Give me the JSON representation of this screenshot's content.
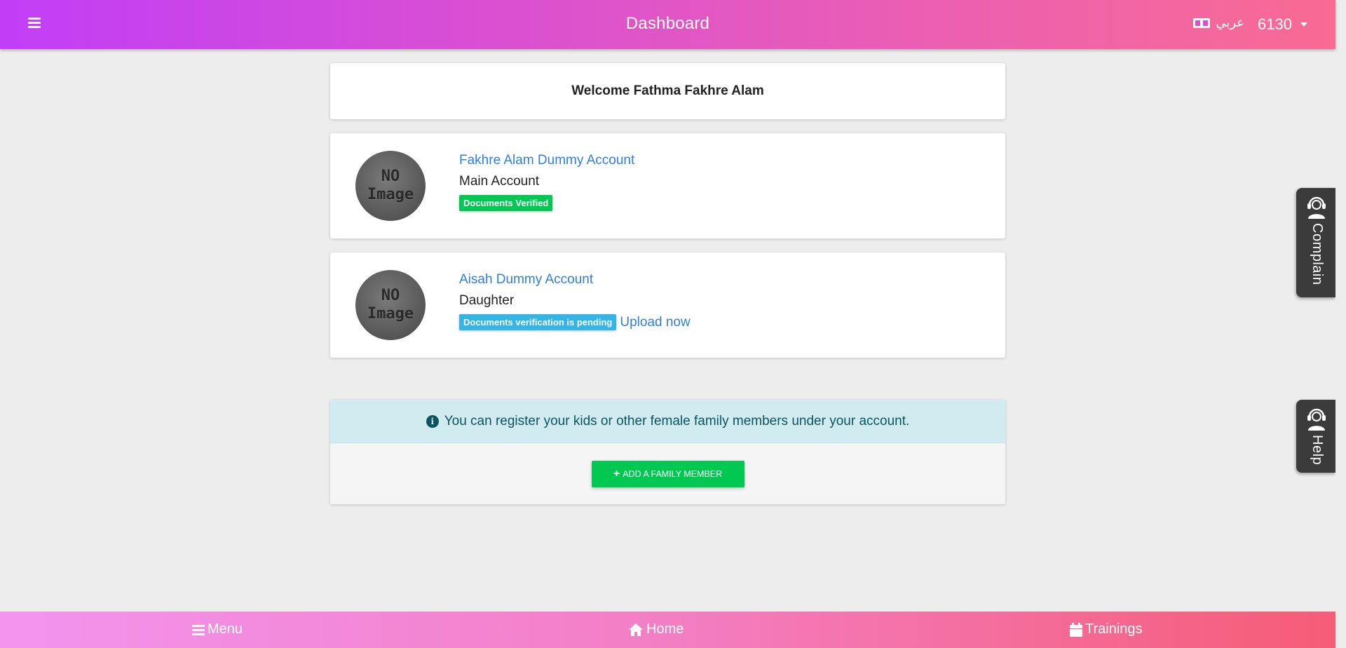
{
  "header": {
    "title": "Dashboard",
    "language_label": "عربي",
    "user_id": "6130"
  },
  "welcome": {
    "text": "Welcome Fathma Fakhre Alam"
  },
  "members": [
    {
      "avatar_line1": "NO",
      "avatar_line2": "Image",
      "name": "Fakhre Alam Dummy Account",
      "relation": "Main Account",
      "status": "Documents Verified",
      "status_color": "#00c853",
      "action": ""
    },
    {
      "avatar_line1": "NO",
      "avatar_line2": "Image",
      "name": "Aisah Dummy Account",
      "relation": "Daughter",
      "status": "Documents verification is pending",
      "status_color": "#33b5e5",
      "action": "Upload now"
    }
  ],
  "register": {
    "info_text": "You can register your kids or other female family members under your account.",
    "button_label": "ADD A FAMILY MEMBER"
  },
  "side_tabs": {
    "complain_label": "Complain",
    "help_label": "Help"
  },
  "bottom_nav": {
    "menu_label": "Menu",
    "home_label": "Home",
    "trainings_label": "Trainings"
  },
  "colors": {
    "header_gradient_start": "#c13ef7",
    "header_gradient_end": "#f86b93",
    "link": "#2f7fde",
    "success": "#00c853",
    "info": "#33b5e5"
  }
}
